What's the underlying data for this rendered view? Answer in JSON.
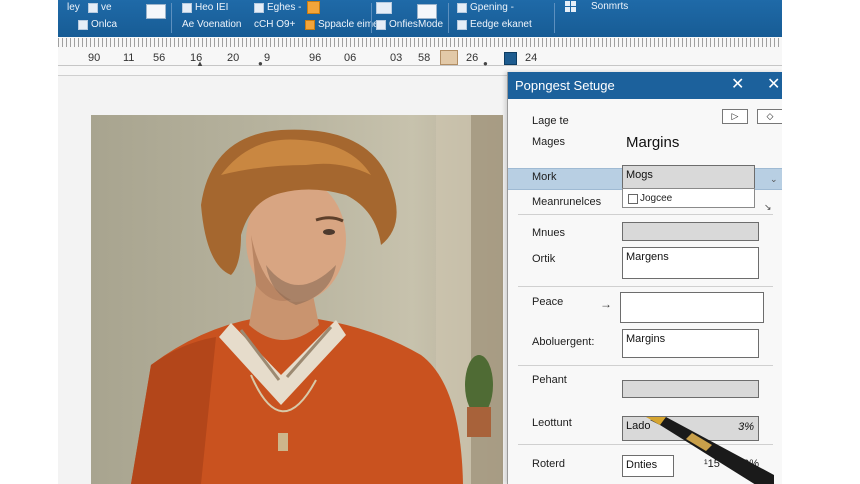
{
  "ribbon": {
    "items": [
      {
        "id": "rb-1",
        "label": "ley",
        "icon": "text-icon"
      },
      {
        "id": "rb-2",
        "label": "ve",
        "icon": "text-icon"
      },
      {
        "id": "rb-3",
        "label": "Onlca",
        "icon": "doc-icon"
      },
      {
        "id": "rb-4",
        "label": "Heo IEI",
        "icon": "doc-icon"
      },
      {
        "id": "rb-5",
        "label": "Eghes -",
        "icon": "style-icon"
      },
      {
        "id": "rb-6",
        "label": "Ae Voenation",
        "icon": "text-icon"
      },
      {
        "id": "rb-7",
        "label": "cCH O9+",
        "icon": "text-icon"
      },
      {
        "id": "rb-8",
        "label": "Sppacle eimes",
        "icon": "text-icon"
      },
      {
        "id": "rb-9",
        "label": "Onfies",
        "icon": "doc-icon"
      },
      {
        "id": "rb-10",
        "label": "Mode",
        "icon": "doc-icon"
      },
      {
        "id": "rb-11",
        "label": "Gpening -",
        "icon": "layout-icon"
      },
      {
        "id": "rb-12",
        "label": "Sonmrts",
        "icon": "grid-icon"
      },
      {
        "id": "rb-13",
        "label": "Eedge ekanet",
        "icon": "text-icon"
      }
    ]
  },
  "ruler": {
    "numbers": [
      "90",
      "11",
      "56",
      "16",
      "20",
      "9",
      "96",
      "06",
      "03",
      "58",
      "26",
      "24"
    ]
  },
  "dialog": {
    "title": "Popngest Setuge",
    "close_glyph": "✕",
    "nav_prev": "▷",
    "nav_next": "◇",
    "labels": {
      "lage": "Lage te",
      "mages": "Mages",
      "mork": "Mork",
      "meanrunelces": "Meanrunelces",
      "mnues": "Mnues",
      "ortik": "Ortik",
      "peace": "Peace",
      "aboluergent": "Aboluergent:",
      "pehant": "Pehant",
      "leottunt": "Leottunt",
      "roterd": "Roterd"
    },
    "heading": "Margins",
    "fields": {
      "mogs": "Mogs",
      "jogcee": "Jogcee",
      "ortik_value": "Margens",
      "abolue_value": "Margins",
      "leottunt_value": "Lado",
      "leottunt_pct": "3%",
      "roterd_value": "Dnties",
      "roterd_num": "¹15",
      "roterd_pct": "00%"
    },
    "arrow": "→"
  }
}
